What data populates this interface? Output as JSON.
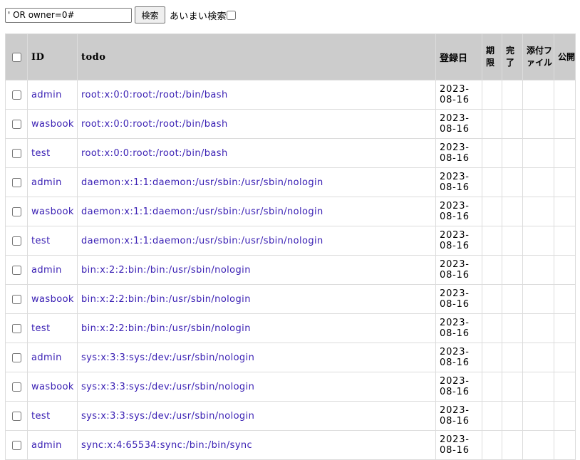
{
  "search": {
    "value": "' OR owner=0#",
    "button_label": "検索",
    "fuzzy_label": "あいまい検索"
  },
  "table": {
    "headers": {
      "id": "ID",
      "todo": "todo",
      "registered": "登録日",
      "deadline": "期限",
      "done": "完了",
      "attachment": "添付ファイル",
      "public": "公開"
    },
    "rows": [
      {
        "id": "admin",
        "todo": "root:x:0:0:root:/root:/bin/bash",
        "date": "2023-08-16"
      },
      {
        "id": "wasbook",
        "todo": "root:x:0:0:root:/root:/bin/bash",
        "date": "2023-08-16"
      },
      {
        "id": "test",
        "todo": "root:x:0:0:root:/root:/bin/bash",
        "date": "2023-08-16"
      },
      {
        "id": "admin",
        "todo": "daemon:x:1:1:daemon:/usr/sbin:/usr/sbin/nologin",
        "date": "2023-08-16"
      },
      {
        "id": "wasbook",
        "todo": "daemon:x:1:1:daemon:/usr/sbin:/usr/sbin/nologin",
        "date": "2023-08-16"
      },
      {
        "id": "test",
        "todo": "daemon:x:1:1:daemon:/usr/sbin:/usr/sbin/nologin",
        "date": "2023-08-16"
      },
      {
        "id": "admin",
        "todo": "bin:x:2:2:bin:/bin:/usr/sbin/nologin",
        "date": "2023-08-16"
      },
      {
        "id": "wasbook",
        "todo": "bin:x:2:2:bin:/bin:/usr/sbin/nologin",
        "date": "2023-08-16"
      },
      {
        "id": "test",
        "todo": "bin:x:2:2:bin:/bin:/usr/sbin/nologin",
        "date": "2023-08-16"
      },
      {
        "id": "admin",
        "todo": "sys:x:3:3:sys:/dev:/usr/sbin/nologin",
        "date": "2023-08-16"
      },
      {
        "id": "wasbook",
        "todo": "sys:x:3:3:sys:/dev:/usr/sbin/nologin",
        "date": "2023-08-16"
      },
      {
        "id": "test",
        "todo": "sys:x:3:3:sys:/dev:/usr/sbin/nologin",
        "date": "2023-08-16"
      },
      {
        "id": "admin",
        "todo": "sync:x:4:65534:sync:/bin:/bin/sync",
        "date": "2023-08-16"
      }
    ]
  },
  "colors": {
    "link": "#3a20b4",
    "header_bg": "#cccccc",
    "border": "#dcdcdc"
  }
}
